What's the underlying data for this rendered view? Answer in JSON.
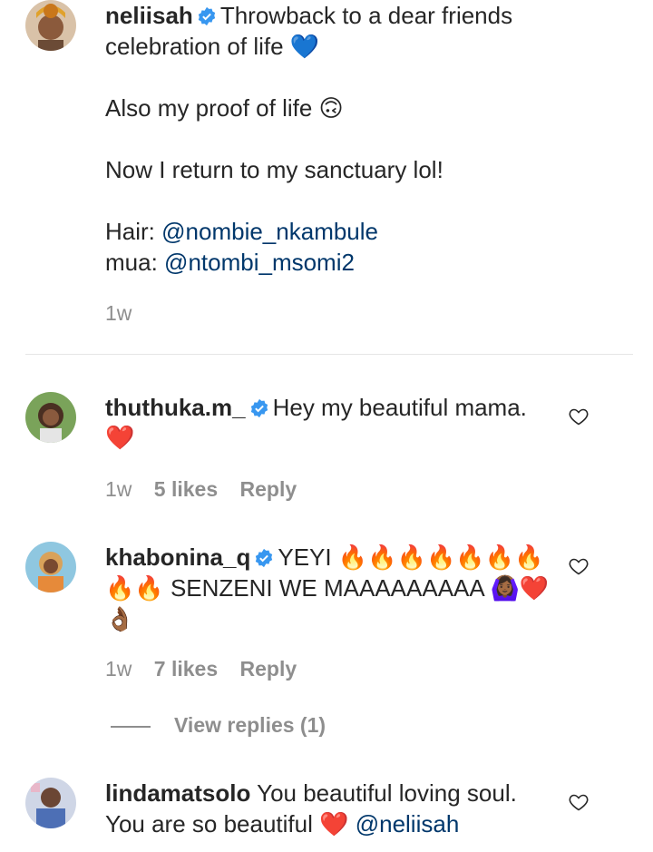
{
  "post_caption": {
    "username": "neliisah",
    "lines": [
      "Throwback to a dear friends",
      "celebration of life 💙",
      "Also my proof of life 🙃",
      "Now I return to my sanctuary lol!",
      "Hair:",
      "@nombie_nkambule",
      "mua:",
      "@ntombi_msomi2"
    ],
    "time": "1w"
  },
  "comments": [
    {
      "username": "thuthuka.m_",
      "text_line1": "Hey my beautiful mama.",
      "text_line2": "❤️",
      "time": "1w",
      "likes": "5 likes",
      "reply": "Reply"
    },
    {
      "username": "khabonina_q",
      "text_line1": "YEYI 🔥🔥🔥🔥🔥🔥🔥",
      "text_line2": "🔥🔥 SENZENI WE MAAAAAAAAA 🙆🏾‍♀️❤️",
      "text_line3": "👌🏾",
      "time": "1w",
      "likes": "7 likes",
      "reply": "Reply",
      "view_replies": "View replies (1)"
    },
    {
      "username": "lindamatsolo",
      "text_line1": "You beautiful loving soul.",
      "text_line2_prefix": "You are so beautiful ❤️",
      "mention": "@neliisah"
    }
  ],
  "colors": {
    "text": "#262626",
    "muted": "#8e8e8e",
    "mention": "#00376b",
    "verified": "#3897f0"
  }
}
